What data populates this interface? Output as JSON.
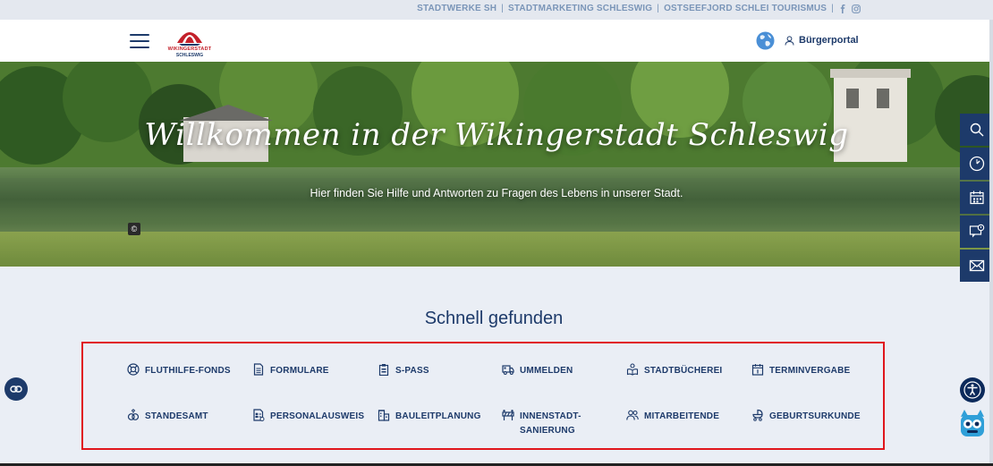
{
  "topbar": {
    "links": [
      "STADTWERKE SH",
      "STADTMARKETING SCHLESWIG",
      "OSTSEEFJORD SCHLEI TOURISMUS"
    ],
    "separator": "|"
  },
  "header": {
    "logo_line1": "WIKINGERSTADT",
    "logo_line2": "SCHLESWIG",
    "portal_label": "Bürgerportal"
  },
  "hero": {
    "title": "Willkommen in der Wikingerstadt Schleswig",
    "subtitle": "Hier finden Sie Hilfe und Antworten zu Fragen des Lebens in unserer Stadt.",
    "copyright": "©"
  },
  "quick": {
    "title": "Schnell gefunden",
    "items": [
      {
        "label": "FLUTHILFE-FONDS",
        "icon": "lifebuoy-icon"
      },
      {
        "label": "FORMULARE",
        "icon": "document-icon"
      },
      {
        "label": "S-PASS",
        "icon": "clipboard-icon"
      },
      {
        "label": "UMMELDEN",
        "icon": "truck-icon"
      },
      {
        "label": "STADTBÜCHEREI",
        "icon": "reader-icon"
      },
      {
        "label": "TERMINVERGABE",
        "icon": "calendar-icon"
      },
      {
        "label": "STANDESAMT",
        "icon": "rings-icon"
      },
      {
        "label": "PERSONALAUSWEIS",
        "icon": "id-card-icon"
      },
      {
        "label": "BAULEITPLANUNG",
        "icon": "building-icon"
      },
      {
        "label": "INNENSTADT-",
        "label2": "SANIERUNG",
        "icon": "construction-icon"
      },
      {
        "label": "MITARBEITENDE",
        "icon": "people-icon"
      },
      {
        "label": "GEBURTSURKUNDE",
        "icon": "stroller-icon"
      }
    ]
  },
  "colors": {
    "navy": "#1d3a6a",
    "accent_red": "#c3202a",
    "highlight_border": "#e0161c",
    "topbar_link": "#7a95b8",
    "background": "#eaeef5"
  }
}
